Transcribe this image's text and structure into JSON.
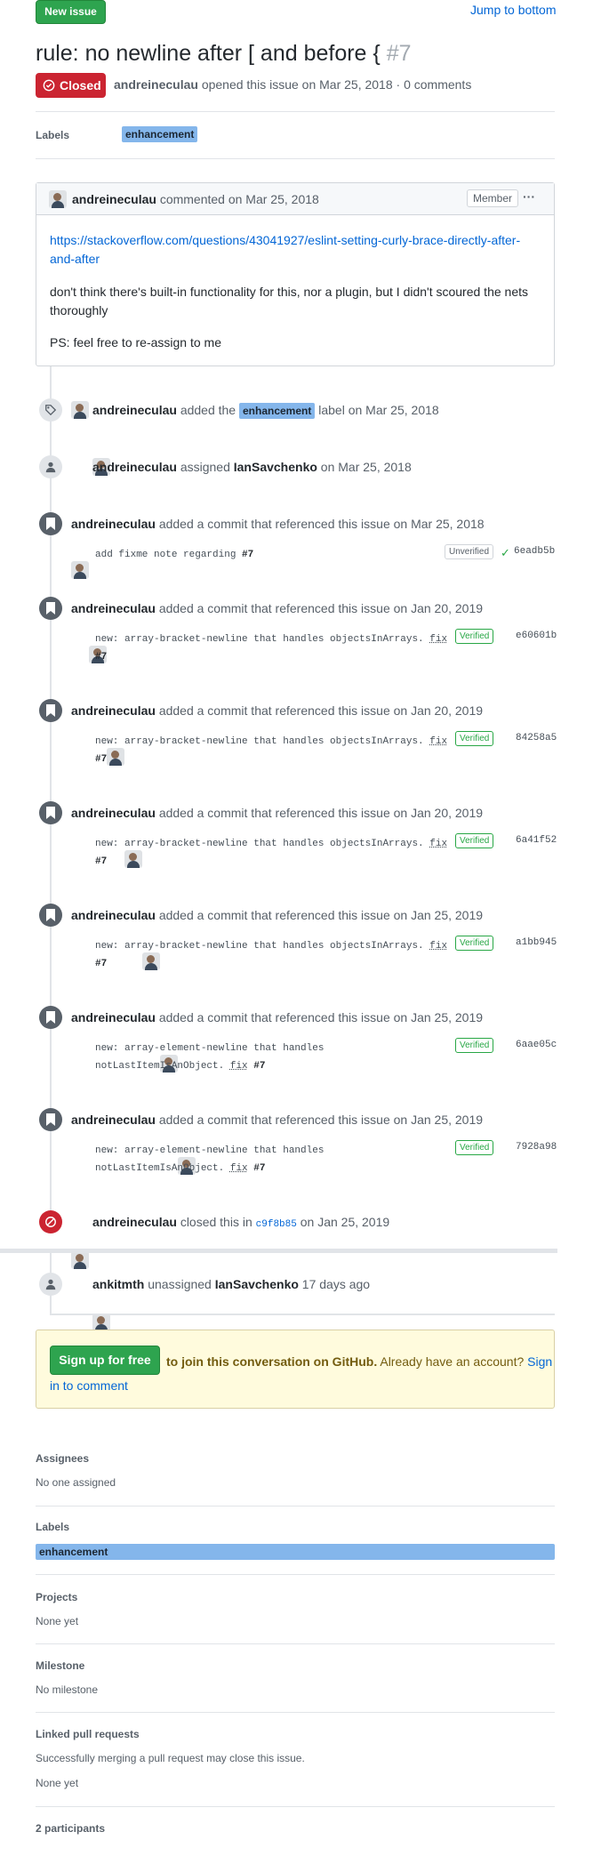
{
  "header": {
    "new_issue": "New issue",
    "jump_to_bottom": "Jump to bottom",
    "title": "rule: no newline after [ and before {",
    "number": "#7",
    "status": "Closed",
    "meta_author": "andreineculau",
    "meta_text": "opened this issue on Mar 25, 2018 · 0 comments"
  },
  "labels_row": {
    "heading": "Labels",
    "label": "enhancement"
  },
  "comment": {
    "author": "andreineculau",
    "action": "commented on Mar 25, 2018",
    "role": "Member",
    "more": "···",
    "link_line1": "https://stackoverflow.com/questions/43041927/eslint-setting-curly-brace-directly-after-",
    "link_line2": "and-after",
    "para1_line1": "don't think there's built-in functionality for this, nor a plugin, but I didn't scoured the nets",
    "para1_line2": "thoroughly",
    "para2": "PS: feel free to re-assign to me"
  },
  "events": {
    "label_added": {
      "actor": "andreineculau",
      "pre": "added the",
      "label": "enhancement",
      "post": "label on Mar 25, 2018"
    },
    "assigned": {
      "actor": "andreineculau",
      "pre": "assigned",
      "assignee": "IanSavchenko",
      "post": "on Mar 25, 2018"
    },
    "commits": [
      {
        "actor": "andreineculau",
        "text": "added a commit that referenced this issue on Mar 25, 2018",
        "msg1": "add fixme note regarding",
        "ref": "#7",
        "msg2": "",
        "fix": "",
        "badge": "Unverified",
        "sha": "6eadb5b"
      },
      {
        "actor": "andreineculau",
        "text": "added a commit that referenced this issue on Jan 20, 2019",
        "msg1": "new: array-bracket-newline that handles objectsInArrays.",
        "fix": "fix",
        "ref": "#7",
        "badge": "Verified",
        "sha": "e60601b"
      },
      {
        "actor": "andreineculau",
        "text": "added a commit that referenced this issue on Jan 20, 2019",
        "msg1": "new: array-bracket-newline that handles objectsInArrays.",
        "fix": "fix",
        "ref": "#7",
        "badge": "Verified",
        "sha": "84258a5"
      },
      {
        "actor": "andreineculau",
        "text": "added a commit that referenced this issue on Jan 20, 2019",
        "msg1": "new: array-bracket-newline that handles objectsInArrays.",
        "fix": "fix",
        "ref": "#7",
        "badge": "Verified",
        "sha": "6a41f52"
      },
      {
        "actor": "andreineculau",
        "text": "added a commit that referenced this issue on Jan 25, 2019",
        "msg1": "new: array-bracket-newline that handles objectsInArrays.",
        "fix": "fix",
        "ref": "#7",
        "badge": "Verified",
        "sha": "a1bb945"
      },
      {
        "actor": "andreineculau",
        "text": "added a commit that referenced this issue on Jan 25, 2019",
        "msg1": "new: array-element-newline that handles",
        "msg2": "notLastItemIsAnObject.",
        "fix": "fix",
        "ref": "#7",
        "badge": "Verified",
        "sha": "6aae05c"
      },
      {
        "actor": "andreineculau",
        "text": "added a commit that referenced this issue on Jan 25, 2019",
        "msg1": "new: array-element-newline that handles",
        "msg2": "notLastItemIsAnObject.",
        "fix": "fix",
        "ref": "#7",
        "badge": "Verified",
        "sha": "7928a98"
      }
    ],
    "closed": {
      "actor": "andreineculau",
      "pre": "closed this in",
      "sha": "c9f8b85",
      "post": "on Jan 25, 2019"
    },
    "unassigned": {
      "actor": "ankitmth",
      "pre": "unassigned",
      "assignee": "IanSavchenko",
      "post": "17 days ago"
    }
  },
  "signup": {
    "button": "Sign up for free",
    "text": "to join this conversation on GitHub.",
    "already": "Already have an account?",
    "signin1": "Sign",
    "signin2": "in to comment"
  },
  "sidebar": {
    "assignees": {
      "heading": "Assignees",
      "value": "No one assigned"
    },
    "labels": {
      "heading": "Labels",
      "value": "enhancement"
    },
    "projects": {
      "heading": "Projects",
      "value": "None yet"
    },
    "milestone": {
      "heading": "Milestone",
      "value": "No milestone"
    },
    "linked": {
      "heading": "Linked pull requests",
      "desc": "Successfully merging a pull request may close this issue.",
      "value": "None yet"
    },
    "participants": {
      "heading": "2 participants"
    }
  },
  "colors": {
    "green": "#2ea44f",
    "closed_red": "#cb2431",
    "label_blue": "#84b6eb",
    "link": "#0366d6"
  }
}
